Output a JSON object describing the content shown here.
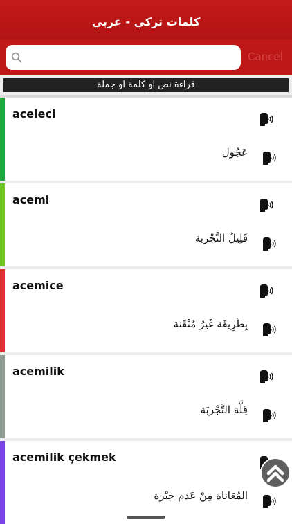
{
  "app": {
    "title": "كلمات تركي - عربي"
  },
  "search": {
    "placeholder": "",
    "value": "",
    "cancel_label": "Cancel"
  },
  "hint": "قراءة  نص او كلمة او جملة",
  "entries": [
    {
      "word": "aceleci",
      "translation": "عَجُول",
      "accent": "#22a43c"
    },
    {
      "word": "acemi",
      "translation": "قَلِيلُ التَّجْربة",
      "accent": "#6cc32a"
    },
    {
      "word": "acemice",
      "translation": "بِطَرِيقَة غَيرُ مُتْقَنة",
      "accent": "#e03236"
    },
    {
      "word": "acemilik",
      "translation": "قِلَّة التَّجْربَة",
      "accent": "#8c9a92"
    },
    {
      "word": "acemilik çekmek",
      "translation": "المُعَاناة مِنْ عَدم خِبْرة",
      "accent": "#7a45e0"
    }
  ],
  "icons": {
    "speak": "speaker-head-icon",
    "search": "magnifier-icon",
    "scroll_top": "double-chevron-up-icon"
  }
}
